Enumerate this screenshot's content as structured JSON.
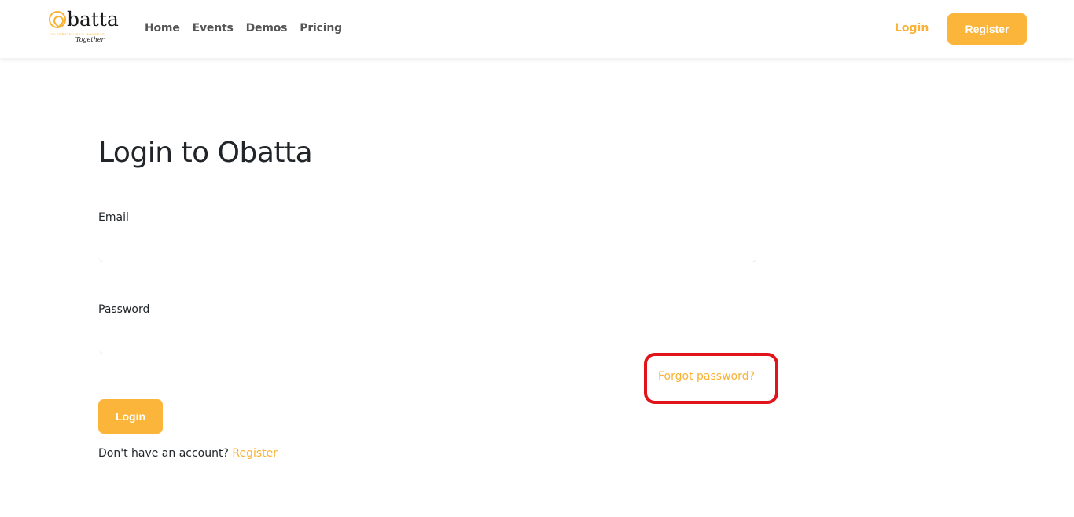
{
  "brand": {
    "name": "batta",
    "tagline": "CELEBRATE LIFE'S MOMENTS",
    "script": "Together",
    "accent_color": "#f9b233"
  },
  "nav": {
    "links": [
      {
        "label": "Home"
      },
      {
        "label": "Events"
      },
      {
        "label": "Demos"
      },
      {
        "label": "Pricing"
      }
    ],
    "login_label": "Login",
    "register_label": "Register"
  },
  "form": {
    "title": "Login to Obatta",
    "email": {
      "label": "Email",
      "value": "",
      "placeholder": ""
    },
    "password": {
      "label": "Password",
      "value": "",
      "placeholder": ""
    },
    "forgot_label": "Forgot password?",
    "submit_label": "Login",
    "signup_prompt": "Don't have an account?",
    "signup_link": "Register"
  },
  "annotation": {
    "highlight_color": "#e0141a"
  }
}
